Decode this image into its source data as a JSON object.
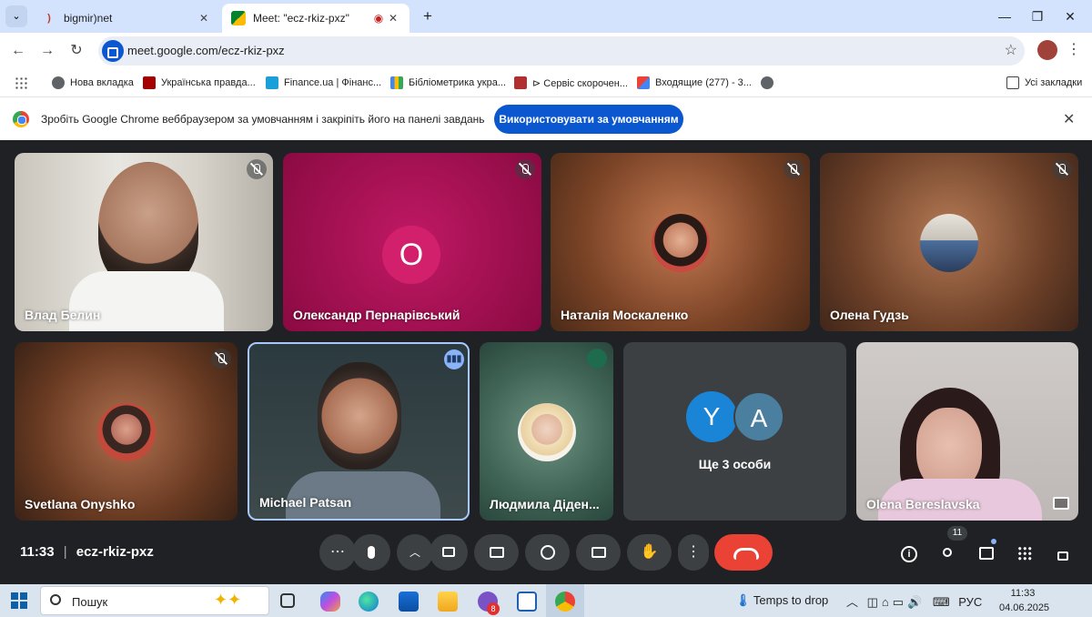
{
  "browser": {
    "tabs": [
      {
        "title": "bigmir)net",
        "icon": "bigmir-icon",
        "active": false
      },
      {
        "title": "Meet: \"ecz-rkiz-pxz\"",
        "icon": "meet-icon",
        "active": true
      }
    ],
    "url": "meet.google.com/ecz-rkiz-pxz",
    "bookmarks": [
      "Нова вкладка",
      "Українська правда...",
      "Finance.ua | Фінанс...",
      "Бібліометрика укра...",
      "⊳ Сервіс скорочен...",
      "Входящие (277) - 3...",
      "Усі закладки"
    ],
    "infobar": {
      "text": "Зробіть Google Chrome веббраузером за умовчанням і закріпіть його на панелі завдань",
      "button": "Використовувати за умовчанням"
    }
  },
  "meet": {
    "time": "11:33",
    "separator": "|",
    "room": "ecz-rkiz-pxz",
    "participants": [
      {
        "name": "Влад Белин",
        "muted": true
      },
      {
        "name": "Олександр Пернарівський",
        "initial": "О",
        "muted": true
      },
      {
        "name": "Наталія Москаленко",
        "muted": true
      },
      {
        "name": "Олена Гудзь",
        "muted": true
      },
      {
        "name": "Svetlana Onyshko",
        "muted": true
      },
      {
        "name": "Michael Patsan",
        "speaking": true
      },
      {
        "name": "Людмила Діден...",
        "muted": true
      },
      {
        "name": "Olena Bereslavska"
      }
    ],
    "more": {
      "label": "Ще 3 особи",
      "initials": [
        "Y",
        "A"
      ]
    },
    "people_count": "11"
  },
  "taskbar": {
    "search_placeholder": "Пошук",
    "weather": "Temps to drop",
    "language": "РУС",
    "time": "11:33",
    "date": "04.06.2025",
    "chat_badge": "8"
  },
  "colors": {
    "accent": "#0b57d0",
    "end_call": "#ea4335",
    "meet_bg": "#202124",
    "tile_magenta": "#a50f52",
    "avatar_y": "#1a85d6",
    "avatar_a": "#4a7fa0"
  }
}
